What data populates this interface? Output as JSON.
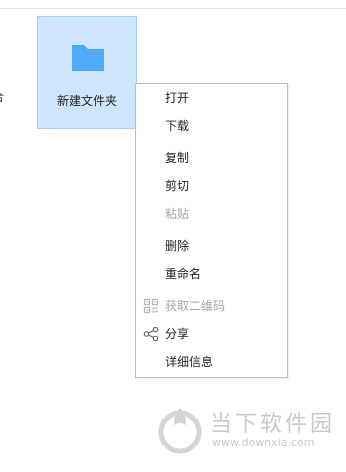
{
  "explorer": {
    "left_fragment_text": "合",
    "folder": {
      "name": "新建文件夹",
      "icon": "folder-icon",
      "icon_color": "#4daaf7",
      "selected": true
    }
  },
  "context_menu": {
    "items": [
      {
        "label": "打开",
        "enabled": true
      },
      {
        "label": "下载",
        "enabled": true
      },
      {
        "label": "复制",
        "enabled": true
      },
      {
        "label": "剪切",
        "enabled": true
      },
      {
        "label": "粘贴",
        "enabled": false
      },
      {
        "label": "删除",
        "enabled": true
      },
      {
        "label": "重命名",
        "enabled": true
      },
      {
        "label": "获取二维码",
        "enabled": false,
        "icon": "qrcode-icon"
      },
      {
        "label": "分享",
        "enabled": true,
        "icon": "share-icon"
      },
      {
        "label": "详细信息",
        "enabled": true
      }
    ]
  },
  "watermark": {
    "title": "当下软件园",
    "url": "www.downxia.com",
    "color": "#c9c9c9"
  }
}
